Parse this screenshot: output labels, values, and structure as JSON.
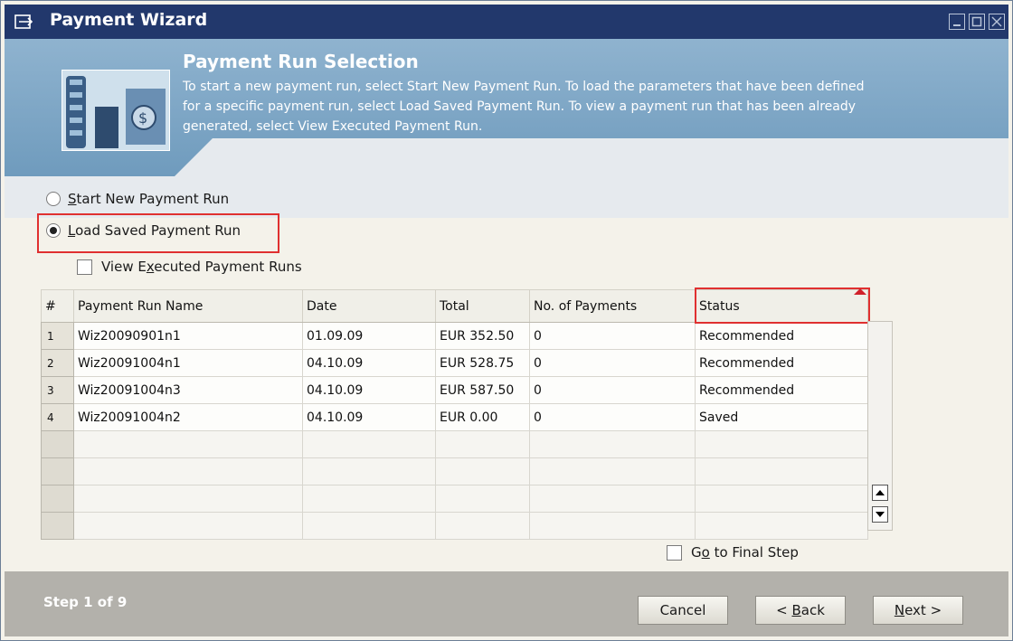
{
  "window": {
    "title": "Payment Wizard"
  },
  "header": {
    "title": "Payment Run Selection",
    "description": "To start a new payment run, select Start New Payment Run. To load the parameters that have been defined for a specific payment run, select Load Saved Payment Run. To view a payment run that has been already generated, select View Executed Payment Run."
  },
  "options": {
    "start_new": {
      "label_first": "S",
      "label_rest": "tart New Payment Run",
      "selected": false
    },
    "load_saved": {
      "label_first": "L",
      "label_rest": "oad Saved Payment Run",
      "selected": true
    },
    "view_executed": {
      "label_pre": "View E",
      "label_u": "x",
      "label_post": "ecuted Payment Runs",
      "checked": false
    }
  },
  "table": {
    "columns": [
      "#",
      "Payment Run Name",
      "Date",
      "Total",
      "No. of Payments",
      "Status"
    ],
    "rows": [
      {
        "num": "1",
        "name": "Wiz20090901n1",
        "date": "01.09.09",
        "total": "EUR 352.50",
        "payments": "0",
        "status": "Recommended"
      },
      {
        "num": "2",
        "name": "Wiz20091004n1",
        "date": "04.10.09",
        "total": "EUR 528.75",
        "payments": "0",
        "status": "Recommended"
      },
      {
        "num": "3",
        "name": "Wiz20091004n3",
        "date": "04.10.09",
        "total": "EUR 587.50",
        "payments": "0",
        "status": "Recommended"
      },
      {
        "num": "4",
        "name": "Wiz20091004n2",
        "date": "04.10.09",
        "total": "EUR 0.00",
        "payments": "0",
        "status": "Saved"
      }
    ]
  },
  "go_final": {
    "label_pre": "G",
    "label_u": "o",
    "label_post": " to Final Step",
    "checked": false
  },
  "footer": {
    "step": "Step 1 of 9",
    "cancel": "Cancel",
    "back_pre": "< ",
    "back_u": "B",
    "back_post": "ack",
    "next_u": "N",
    "next_post": "ext >"
  },
  "colors": {
    "title_bar": "#22386c",
    "header_blue": "#7ea6c6",
    "footer": "#b3b1ab",
    "highlight": "#e03030"
  }
}
